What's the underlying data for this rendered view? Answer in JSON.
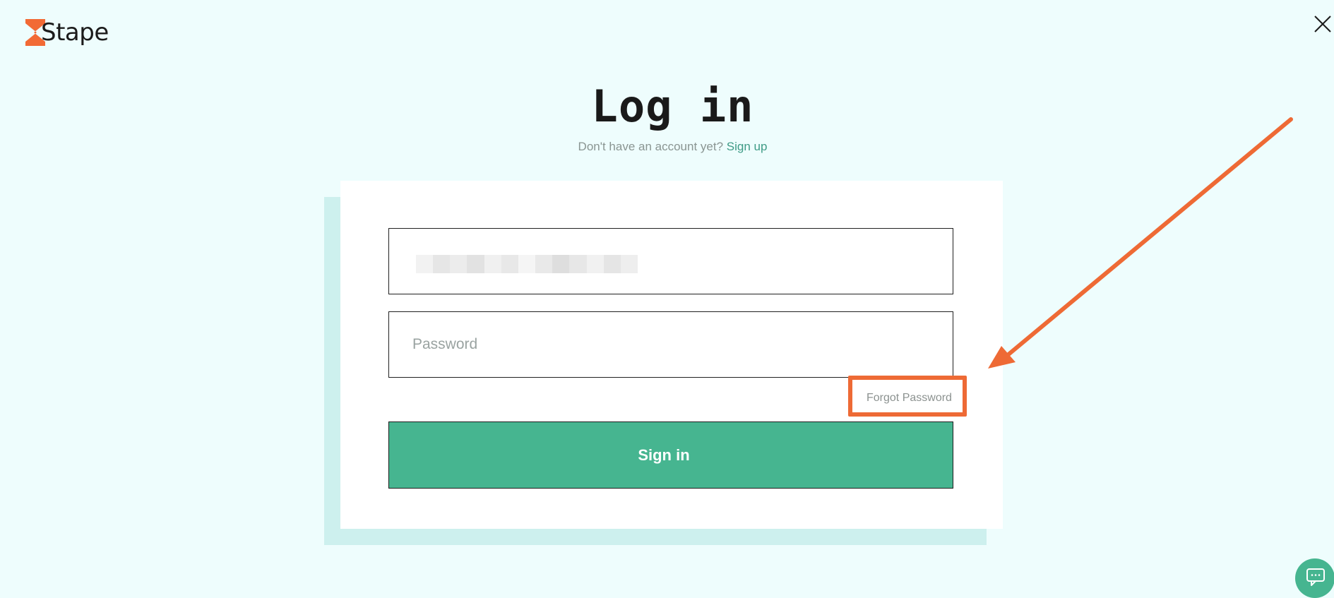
{
  "brand": {
    "name": "Stape",
    "accent_color": "#f26a35"
  },
  "header": {
    "close_icon": "close-icon"
  },
  "page": {
    "title": "Log in",
    "subtitle_text": "Don't have an account yet?",
    "signup_link": "Sign up"
  },
  "form": {
    "email_value": "",
    "email_placeholder": "",
    "password_value": "",
    "password_placeholder": "Password",
    "forgot_label": "Forgot Password",
    "submit_label": "Sign in"
  },
  "annotation": {
    "highlight_color": "#ee6a35",
    "arrow_icon": "arrow-icon"
  },
  "chat": {
    "icon": "chat-bubble-icon",
    "color": "#46b590"
  },
  "colors": {
    "background": "#eefdfd",
    "button": "#46b590",
    "link": "#3f9b86",
    "card_shadow": "#cdf0ee"
  }
}
